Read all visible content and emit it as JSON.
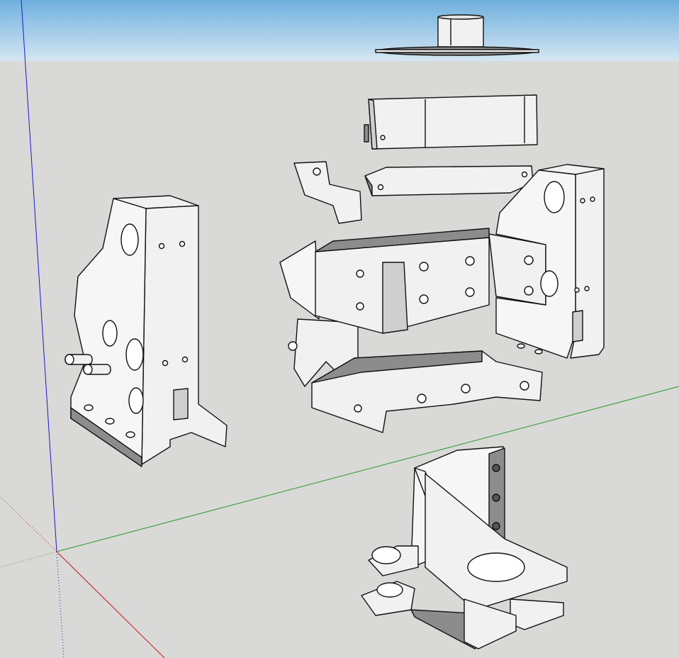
{
  "scene": {
    "type": "3d-cad-viewport",
    "colors": {
      "sky_top": "#6fb0de",
      "sky_bottom": "#d4e6f2",
      "ground": "#d9d9d7",
      "part_face": "#f1f1f1",
      "part_shade": "#8c8c8c",
      "part_edge": "#111111",
      "axis_blue": "#1a1acc",
      "axis_green": "#2a9a2a",
      "axis_red": "#cc1a1a"
    },
    "parts": [
      "pulley",
      "top-cover",
      "left-plate",
      "center-carriage",
      "right-plate",
      "bottom-clamp",
      "base-bracket"
    ]
  }
}
